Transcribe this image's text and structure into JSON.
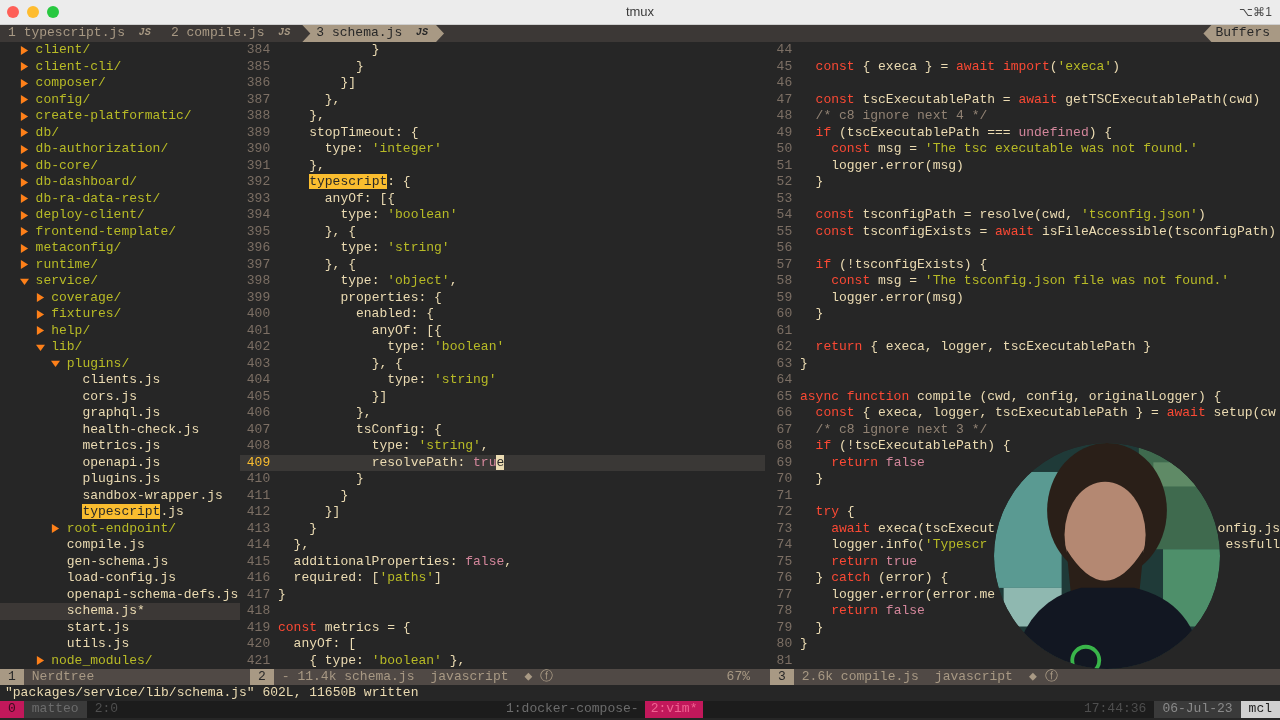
{
  "window": {
    "title": "tmux",
    "shortcut": "⌥⌘1"
  },
  "tabline": {
    "tabs": [
      {
        "number": "1",
        "label": "typescript.js",
        "badge": "JS",
        "selected": false
      },
      {
        "number": "2",
        "label": "compile.js",
        "badge": "JS",
        "selected": false
      },
      {
        "number": "3",
        "label": "schema.js",
        "badge": "JS",
        "selected": true
      }
    ],
    "buffers_label": "Buffers"
  },
  "nerdtree": {
    "items": [
      {
        "name": "client/",
        "kind": "dir",
        "expanded": false,
        "selected": false
      },
      {
        "name": "client-cli/",
        "kind": "dir",
        "expanded": false,
        "selected": false
      },
      {
        "name": "composer/",
        "kind": "dir",
        "expanded": false,
        "selected": false
      },
      {
        "name": "config/",
        "kind": "dir",
        "expanded": false,
        "selected": false
      },
      {
        "name": "create-platformatic/",
        "kind": "dir",
        "expanded": false,
        "selected": false
      },
      {
        "name": "db/",
        "kind": "dir",
        "expanded": false,
        "selected": false
      },
      {
        "name": "db-authorization/",
        "kind": "dir",
        "expanded": false,
        "selected": false
      },
      {
        "name": "db-core/",
        "kind": "dir",
        "expanded": false,
        "selected": false
      },
      {
        "name": "db-dashboard/",
        "kind": "dir",
        "expanded": false,
        "selected": false
      },
      {
        "name": "db-ra-data-rest/",
        "kind": "dir",
        "expanded": false,
        "selected": false
      },
      {
        "name": "deploy-client/",
        "kind": "dir",
        "expanded": false,
        "selected": false
      },
      {
        "name": "frontend-template/",
        "kind": "dir",
        "expanded": false,
        "selected": false
      },
      {
        "name": "metaconfig/",
        "kind": "dir",
        "expanded": false,
        "selected": false
      },
      {
        "name": "runtime/",
        "kind": "dir",
        "expanded": false,
        "selected": false
      },
      {
        "name": "service/",
        "kind": "dir",
        "expanded": true,
        "selected": false,
        "children": [
          {
            "name": "coverage/",
            "kind": "dir",
            "expanded": false,
            "selected": false
          },
          {
            "name": "fixtures/",
            "kind": "dir",
            "expanded": false,
            "selected": false
          },
          {
            "name": "help/",
            "kind": "dir",
            "expanded": false,
            "selected": false
          },
          {
            "name": "lib/",
            "kind": "dir",
            "expanded": true,
            "selected": false,
            "children": [
              {
                "name": "plugins/",
                "kind": "dir",
                "expanded": true,
                "selected": false,
                "children": [
                  {
                    "name": "clients.js",
                    "kind": "file",
                    "selected": false
                  },
                  {
                    "name": "cors.js",
                    "kind": "file",
                    "selected": false
                  },
                  {
                    "name": "graphql.js",
                    "kind": "file",
                    "selected": false
                  },
                  {
                    "name": "health-check.js",
                    "kind": "file",
                    "selected": false
                  },
                  {
                    "name": "metrics.js",
                    "kind": "file",
                    "selected": false
                  },
                  {
                    "name": "openapi.js",
                    "kind": "file",
                    "selected": false
                  },
                  {
                    "name": "plugins.js",
                    "kind": "file",
                    "selected": false
                  },
                  {
                    "name": "sandbox-wrapper.js",
                    "kind": "file",
                    "selected": false
                  },
                  {
                    "highlight": "typescript",
                    "name": ".js",
                    "kind": "file",
                    "selected": false
                  }
                ]
              },
              {
                "name": "root-endpoint/",
                "kind": "dir",
                "expanded": false,
                "selected": false
              },
              {
                "name": "compile.js",
                "kind": "file",
                "selected": false
              },
              {
                "name": "gen-schema.js",
                "kind": "file",
                "selected": false
              },
              {
                "name": "load-config.js",
                "kind": "file",
                "selected": false
              },
              {
                "name": "openapi-schema-defs.js",
                "kind": "file",
                "selected": false
              },
              {
                "name": "schema.js*",
                "kind": "file",
                "selected": true
              },
              {
                "name": "start.js",
                "kind": "file",
                "selected": false
              },
              {
                "name": "utils.js",
                "kind": "file",
                "selected": false
              }
            ]
          },
          {
            "name": "node_modules/",
            "kind": "dir",
            "expanded": false,
            "selected": false
          }
        ]
      }
    ]
  },
  "left_editor": {
    "lines": [
      {
        "number": "384",
        "current": false,
        "tokens": [
          {
            "text": "            }",
            "kind": "plain"
          }
        ]
      },
      {
        "number": "385",
        "current": false,
        "tokens": [
          {
            "text": "          }",
            "kind": "plain"
          }
        ]
      },
      {
        "number": "386",
        "current": false,
        "tokens": [
          {
            "text": "        }]",
            "kind": "plain"
          }
        ]
      },
      {
        "number": "387",
        "current": false,
        "tokens": [
          {
            "text": "      },",
            "kind": "plain"
          }
        ]
      },
      {
        "number": "388",
        "current": false,
        "tokens": [
          {
            "text": "    },",
            "kind": "plain"
          }
        ]
      },
      {
        "number": "389",
        "current": false,
        "tokens": [
          {
            "text": "    stopTimeout: {",
            "kind": "plain"
          }
        ]
      },
      {
        "number": "390",
        "current": false,
        "tokens": [
          {
            "text": "      type: ",
            "kind": "plain"
          },
          {
            "text": "'integer'",
            "kind": "string"
          }
        ]
      },
      {
        "number": "391",
        "current": false,
        "tokens": [
          {
            "text": "    },",
            "kind": "plain"
          }
        ]
      },
      {
        "number": "392",
        "current": false,
        "tokens": [
          {
            "text": "    typescript",
            "kind": "match"
          },
          {
            "text": ": {",
            "kind": "plain"
          }
        ]
      },
      {
        "number": "393",
        "current": false,
        "tokens": [
          {
            "text": "      anyOf: [{",
            "kind": "plain"
          }
        ]
      },
      {
        "number": "394",
        "current": false,
        "tokens": [
          {
            "text": "        type: ",
            "kind": "plain"
          },
          {
            "text": "'boolean'",
            "kind": "string"
          }
        ]
      },
      {
        "number": "395",
        "current": false,
        "tokens": [
          {
            "text": "      }, {",
            "kind": "plain"
          }
        ]
      },
      {
        "number": "396",
        "current": false,
        "tokens": [
          {
            "text": "        type: ",
            "kind": "plain"
          },
          {
            "text": "'string'",
            "kind": "string"
          }
        ]
      },
      {
        "number": "397",
        "current": false,
        "tokens": [
          {
            "text": "      }, {",
            "kind": "plain"
          }
        ]
      },
      {
        "number": "398",
        "current": false,
        "tokens": [
          {
            "text": "        type: ",
            "kind": "plain"
          },
          {
            "text": "'object'",
            "kind": "string"
          },
          {
            "text": ",",
            "kind": "plain"
          }
        ]
      },
      {
        "number": "399",
        "current": false,
        "tokens": [
          {
            "text": "        properties: {",
            "kind": "plain"
          }
        ]
      },
      {
        "number": "400",
        "current": false,
        "tokens": [
          {
            "text": "          enabled: {",
            "kind": "plain"
          }
        ]
      },
      {
        "number": "401",
        "current": false,
        "tokens": [
          {
            "text": "            anyOf: [{",
            "kind": "plain"
          }
        ]
      },
      {
        "number": "402",
        "current": false,
        "tokens": [
          {
            "text": "              type: ",
            "kind": "plain"
          },
          {
            "text": "'boolean'",
            "kind": "string"
          }
        ]
      },
      {
        "number": "403",
        "current": false,
        "tokens": [
          {
            "text": "            }, {",
            "kind": "plain"
          }
        ]
      },
      {
        "number": "404",
        "current": false,
        "tokens": [
          {
            "text": "              type: ",
            "kind": "plain"
          },
          {
            "text": "'string'",
            "kind": "string"
          }
        ]
      },
      {
        "number": "405",
        "current": false,
        "tokens": [
          {
            "text": "            }]",
            "kind": "plain"
          }
        ]
      },
      {
        "number": "406",
        "current": false,
        "tokens": [
          {
            "text": "          },",
            "kind": "plain"
          }
        ]
      },
      {
        "number": "407",
        "current": false,
        "tokens": [
          {
            "text": "          tsConfig: {",
            "kind": "plain"
          }
        ]
      },
      {
        "number": "408",
        "current": false,
        "tokens": [
          {
            "text": "            type: ",
            "kind": "plain"
          },
          {
            "text": "'string'",
            "kind": "string"
          },
          {
            "text": ",",
            "kind": "plain"
          }
        ]
      },
      {
        "number": "409",
        "current": true,
        "tokens": [
          {
            "text": "            resolvePath: ",
            "kind": "plain"
          },
          {
            "text": "tru",
            "kind": "constant"
          },
          {
            "text": "e",
            "kind": "cursor"
          }
        ]
      },
      {
        "number": "410",
        "current": false,
        "tokens": [
          {
            "text": "          }",
            "kind": "plain"
          }
        ]
      },
      {
        "number": "411",
        "current": false,
        "tokens": [
          {
            "text": "        }",
            "kind": "plain"
          }
        ]
      },
      {
        "number": "412",
        "current": false,
        "tokens": [
          {
            "text": "      }]",
            "kind": "plain"
          }
        ]
      },
      {
        "number": "413",
        "current": false,
        "tokens": [
          {
            "text": "    }",
            "kind": "plain"
          }
        ]
      },
      {
        "number": "414",
        "current": false,
        "tokens": [
          {
            "text": "  },",
            "kind": "plain"
          }
        ]
      },
      {
        "number": "415",
        "current": false,
        "tokens": [
          {
            "text": "  additionalProperties: ",
            "kind": "plain"
          },
          {
            "text": "false",
            "kind": "constant"
          },
          {
            "text": ",",
            "kind": "plain"
          }
        ]
      },
      {
        "number": "416",
        "current": false,
        "tokens": [
          {
            "text": "  required: [",
            "kind": "plain"
          },
          {
            "text": "'paths'",
            "kind": "string"
          },
          {
            "text": "]",
            "kind": "plain"
          }
        ]
      },
      {
        "number": "417",
        "current": false,
        "tokens": [
          {
            "text": "}",
            "kind": "plain"
          }
        ]
      },
      {
        "number": "418",
        "current": false
      },
      {
        "number": "419",
        "current": false,
        "tokens": [
          {
            "text": "const",
            "kind": "keyword"
          },
          {
            "text": " metrics = {",
            "kind": "plain"
          }
        ]
      },
      {
        "number": "420",
        "current": false,
        "tokens": [
          {
            "text": "  anyOf: [",
            "kind": "plain"
          }
        ]
      },
      {
        "number": "421",
        "current": false,
        "tokens": [
          {
            "text": "    { type: ",
            "kind": "plain"
          },
          {
            "text": "'boolean'",
            "kind": "string"
          },
          {
            "text": " },",
            "kind": "plain"
          }
        ]
      }
    ]
  },
  "right_editor": {
    "lines": [
      {
        "number": "44",
        "current": false
      },
      {
        "number": "45",
        "current": false,
        "tokens": [
          {
            "text": "  const",
            "kind": "keyword"
          },
          {
            "text": " { execa } = ",
            "kind": "plain"
          },
          {
            "text": "await",
            "kind": "keyword"
          },
          {
            "text": " import",
            "kind": "keyword"
          },
          {
            "text": "(",
            "kind": "plain"
          },
          {
            "text": "'execa'",
            "kind": "string"
          },
          {
            "text": ")",
            "kind": "plain"
          }
        ]
      },
      {
        "number": "46",
        "current": false
      },
      {
        "number": "47",
        "current": false,
        "tokens": [
          {
            "text": "  const",
            "kind": "keyword"
          },
          {
            "text": " tscExecutablePath = ",
            "kind": "plain"
          },
          {
            "text": "await",
            "kind": "keyword"
          },
          {
            "text": " getTSCExecutablePath(cwd)",
            "kind": "plain"
          }
        ]
      },
      {
        "number": "48",
        "current": false,
        "tokens": [
          {
            "text": "  /* c8 ignore next 4 */",
            "kind": "comment"
          }
        ]
      },
      {
        "number": "49",
        "current": false,
        "tokens": [
          {
            "text": "  if",
            "kind": "keyword"
          },
          {
            "text": " (tscExecutablePath === ",
            "kind": "plain"
          },
          {
            "text": "undefined",
            "kind": "constant"
          },
          {
            "text": ") {",
            "kind": "plain"
          }
        ]
      },
      {
        "number": "50",
        "current": false,
        "tokens": [
          {
            "text": "    const",
            "kind": "keyword"
          },
          {
            "text": " msg = ",
            "kind": "plain"
          },
          {
            "text": "'The tsc executable was not found.'",
            "kind": "string"
          }
        ]
      },
      {
        "number": "51",
        "current": false,
        "tokens": [
          {
            "text": "    logger.error(msg)",
            "kind": "plain"
          }
        ]
      },
      {
        "number": "52",
        "current": false,
        "tokens": [
          {
            "text": "  }",
            "kind": "plain"
          }
        ]
      },
      {
        "number": "53",
        "current": false
      },
      {
        "number": "54",
        "current": false,
        "tokens": [
          {
            "text": "  const",
            "kind": "keyword"
          },
          {
            "text": " tsconfigPath = resolve(cwd, ",
            "kind": "plain"
          },
          {
            "text": "'tsconfig.json'",
            "kind": "string"
          },
          {
            "text": ")",
            "kind": "plain"
          }
        ]
      },
      {
        "number": "55",
        "current": false,
        "tokens": [
          {
            "text": "  const",
            "kind": "keyword"
          },
          {
            "text": " tsconfigExists = ",
            "kind": "plain"
          },
          {
            "text": "await",
            "kind": "keyword"
          },
          {
            "text": " isFileAccessible(tsconfigPath)",
            "kind": "plain"
          }
        ]
      },
      {
        "number": "56",
        "current": false
      },
      {
        "number": "57",
        "current": false,
        "tokens": [
          {
            "text": "  if",
            "kind": "keyword"
          },
          {
            "text": " (!tsconfigExists) {",
            "kind": "plain"
          }
        ]
      },
      {
        "number": "58",
        "current": false,
        "tokens": [
          {
            "text": "    const",
            "kind": "keyword"
          },
          {
            "text": " msg = ",
            "kind": "plain"
          },
          {
            "text": "'The tsconfig.json file was not found.'",
            "kind": "string"
          }
        ]
      },
      {
        "number": "59",
        "current": false,
        "tokens": [
          {
            "text": "    logger.error(msg)",
            "kind": "plain"
          }
        ]
      },
      {
        "number": "60",
        "current": false,
        "tokens": [
          {
            "text": "  }",
            "kind": "plain"
          }
        ]
      },
      {
        "number": "61",
        "current": false
      },
      {
        "number": "62",
        "current": false,
        "tokens": [
          {
            "text": "  return",
            "kind": "keyword"
          },
          {
            "text": " { execa, logger, tscExecutablePath }",
            "kind": "plain"
          }
        ]
      },
      {
        "number": "63",
        "current": false,
        "tokens": [
          {
            "text": "}",
            "kind": "plain"
          }
        ]
      },
      {
        "number": "64",
        "current": false
      },
      {
        "number": "65",
        "current": false,
        "tokens": [
          {
            "text": "async function",
            "kind": "keyword"
          },
          {
            "text": " compile (cwd, config, originalLogger) {",
            "kind": "plain"
          }
        ]
      },
      {
        "number": "66",
        "current": false,
        "tokens": [
          {
            "text": "  const",
            "kind": "keyword"
          },
          {
            "text": " { execa, logger, tscExecutablePath } = ",
            "kind": "plain"
          },
          {
            "text": "await",
            "kind": "keyword"
          },
          {
            "text": " setup(cw",
            "kind": "plain"
          }
        ]
      },
      {
        "number": "67",
        "current": false,
        "tokens": [
          {
            "text": "  /* c8 ignore next 3 */",
            "kind": "comment"
          }
        ]
      },
      {
        "number": "68",
        "current": false,
        "tokens": [
          {
            "text": "  if",
            "kind": "keyword"
          },
          {
            "text": " (!tscExecutablePath) {",
            "kind": "plain"
          }
        ]
      },
      {
        "number": "69",
        "current": false,
        "tokens": [
          {
            "text": "    return",
            "kind": "keyword"
          },
          {
            "text": " false",
            "kind": "constant"
          }
        ]
      },
      {
        "number": "70",
        "current": false,
        "tokens": [
          {
            "text": "  }",
            "kind": "plain"
          }
        ]
      },
      {
        "number": "71",
        "current": false
      },
      {
        "number": "72",
        "current": false,
        "tokens": [
          {
            "text": "  try",
            "kind": "keyword"
          },
          {
            "text": " {",
            "kind": "plain"
          }
        ]
      },
      {
        "number": "73",
        "current": false,
        "tokens": [
          {
            "text": "    await",
            "kind": "keyword"
          },
          {
            "text": " execa(tscExecut",
            "kind": "plain"
          },
          {
            "text": "onfig.js",
            "kind": "tail"
          }
        ]
      },
      {
        "number": "74",
        "current": false,
        "tokens": [
          {
            "text": "    logger.info(",
            "kind": "plain"
          },
          {
            "text": "'Typescr",
            "kind": "string"
          },
          {
            "text": "essfull",
            "kind": "tail"
          }
        ]
      },
      {
        "number": "75",
        "current": false,
        "tokens": [
          {
            "text": "    return",
            "kind": "keyword"
          },
          {
            "text": " true",
            "kind": "constant"
          }
        ]
      },
      {
        "number": "76",
        "current": false,
        "tokens": [
          {
            "text": "  } ",
            "kind": "plain"
          },
          {
            "text": "catch",
            "kind": "keyword"
          },
          {
            "text": " (error) {",
            "kind": "plain"
          }
        ]
      },
      {
        "number": "77",
        "current": false,
        "tokens": [
          {
            "text": "    logger.error(error.me",
            "kind": "plain"
          }
        ]
      },
      {
        "number": "78",
        "current": false,
        "tokens": [
          {
            "text": "    return",
            "kind": "keyword"
          },
          {
            "text": " false",
            "kind": "constant"
          }
        ]
      },
      {
        "number": "79",
        "current": false,
        "tokens": [
          {
            "text": "  }",
            "kind": "plain"
          }
        ]
      },
      {
        "number": "80",
        "current": false,
        "tokens": [
          {
            "text": "}",
            "kind": "plain"
          }
        ]
      },
      {
        "number": "81",
        "current": false
      }
    ]
  },
  "status_lines": [
    {
      "number": "1",
      "name": "Nerdtree"
    },
    {
      "number": "2",
      "flag": "-",
      "size": "11.4k",
      "file": "schema.js",
      "filetype": "javascript",
      "marks": [
        "◆",
        "ⓕ"
      ],
      "percent": "67%"
    },
    {
      "number": "3",
      "size": "2.6k",
      "file": "compile.js",
      "filetype": "javascript",
      "marks": [
        "◆",
        "ⓕ"
      ]
    }
  ],
  "command_line": "\"packages/service/lib/schema.js\" 602L, 11650B written",
  "tmux": {
    "session_index": "0",
    "user": "matteo",
    "pane": "2:0",
    "windows": [
      {
        "label": "1:docker-compose-",
        "selected": false
      },
      {
        "label": "2:vim*",
        "selected": true
      }
    ],
    "time": "17:44:36",
    "date": "06-Jul-23",
    "host": "mcl"
  }
}
